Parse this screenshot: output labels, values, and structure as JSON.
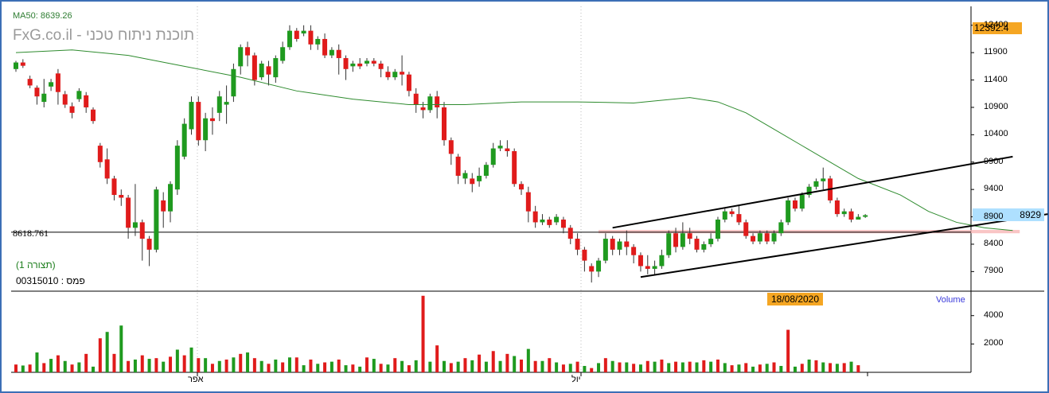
{
  "chart_data": {
    "type": "candlestick",
    "indicator_label": "MA50: 8639.26",
    "watermark": "FxG.co.il - תוכנת ניתוח טכני",
    "last_price_badge": "8929",
    "high_badge": "12392.4",
    "horizontal_line_label": "8618.761",
    "date_badge": "18/08/2020",
    "volume_label": "Volume",
    "meta": {
      "line1": "(תצורה 1)",
      "line2": "פמס : 00315010"
    },
    "y_ticks": [
      "12400",
      "11900",
      "11400",
      "10900",
      "10400",
      "9900",
      "9400",
      "8900",
      "8400",
      "7900"
    ],
    "y_tick_values": [
      12400,
      11900,
      11400,
      10900,
      10400,
      9900,
      9400,
      8900,
      8400,
      7900
    ],
    "volume_ticks": [
      "4000",
      "2000"
    ],
    "volume_tick_values": [
      4000,
      2000
    ],
    "x_ticks": [
      "אפר",
      "יול"
    ],
    "price_range": [
      7600,
      12600
    ],
    "volume_range": [
      0,
      5500
    ],
    "candles": [
      [
        11600,
        11720,
        11550,
        11750,
        0
      ],
      [
        11720,
        11660,
        11620,
        11780,
        0
      ],
      [
        11420,
        11300,
        11250,
        11480,
        0
      ],
      [
        11260,
        11100,
        10950,
        11300,
        0
      ],
      [
        11000,
        11150,
        10900,
        11420,
        0
      ],
      [
        11280,
        11360,
        11200,
        11420,
        0
      ],
      [
        11520,
        11180,
        10950,
        11600,
        0
      ],
      [
        11140,
        10950,
        10890,
        11200,
        0
      ],
      [
        10920,
        10800,
        10700,
        10990,
        0
      ],
      [
        11050,
        11200,
        11000,
        11250,
        0
      ],
      [
        11120,
        10900,
        10800,
        11180,
        0
      ],
      [
        10860,
        10650,
        10600,
        10900,
        0
      ],
      [
        10200,
        9900,
        9800,
        10250,
        0
      ],
      [
        9950,
        9600,
        9500,
        10150,
        0
      ],
      [
        9600,
        9300,
        9200,
        9650,
        0
      ],
      [
        9300,
        9250,
        9100,
        9400,
        0
      ],
      [
        9250,
        8700,
        8500,
        9300,
        0
      ],
      [
        8700,
        8800,
        8550,
        9500,
        0
      ],
      [
        8800,
        8500,
        8100,
        8850,
        0
      ],
      [
        8500,
        8300,
        8000,
        8550,
        0
      ],
      [
        8300,
        9400,
        8250,
        9450,
        0
      ],
      [
        9200,
        9000,
        8700,
        9350,
        0
      ],
      [
        9000,
        9500,
        8800,
        9550,
        0
      ],
      [
        9400,
        10200,
        9300,
        10300,
        0
      ],
      [
        10000,
        10600,
        9950,
        10700,
        0
      ],
      [
        10500,
        11000,
        10400,
        11100,
        0
      ],
      [
        11000,
        10300,
        10200,
        11100,
        0
      ],
      [
        10300,
        10700,
        10100,
        10800,
        0
      ],
      [
        10700,
        10650,
        10400,
        10900,
        0
      ],
      [
        10800,
        11100,
        10650,
        11200,
        0
      ],
      [
        10950,
        11000,
        10600,
        11300,
        0
      ],
      [
        11100,
        11600,
        11000,
        11700,
        0
      ],
      [
        11650,
        12000,
        11500,
        12050,
        0
      ],
      [
        12000,
        11850,
        11650,
        12100,
        0
      ],
      [
        11850,
        11400,
        11300,
        11900,
        0
      ],
      [
        11450,
        11700,
        11400,
        11750,
        0
      ],
      [
        11650,
        11500,
        11300,
        11750,
        0
      ],
      [
        11450,
        11800,
        11350,
        11850,
        0
      ],
      [
        11750,
        12000,
        11700,
        12100,
        0
      ],
      [
        12000,
        12300,
        11950,
        12400,
        0
      ],
      [
        12300,
        12150,
        12100,
        12350,
        0
      ],
      [
        12250,
        12300,
        12200,
        12400,
        0
      ],
      [
        12300,
        12050,
        11950,
        12400,
        0
      ],
      [
        12050,
        12150,
        11950,
        12200,
        0
      ],
      [
        12150,
        11850,
        11800,
        12250,
        0
      ],
      [
        11850,
        11950,
        11800,
        12000,
        0
      ],
      [
        11950,
        11800,
        11500,
        12050,
        0
      ],
      [
        11800,
        11600,
        11400,
        11850,
        0
      ],
      [
        11650,
        11700,
        11550,
        11750,
        0
      ],
      [
        11700,
        11650,
        11600,
        11800,
        0
      ],
      [
        11700,
        11750,
        11650,
        11800,
        0
      ],
      [
        11750,
        11700,
        11650,
        11800,
        0
      ],
      [
        11700,
        11600,
        11450,
        11750,
        0
      ],
      [
        11550,
        11450,
        11400,
        11650,
        0
      ],
      [
        11450,
        11550,
        11400,
        11600,
        0
      ],
      [
        11550,
        11500,
        11300,
        11850,
        0
      ],
      [
        11500,
        11200,
        11100,
        11550,
        0
      ],
      [
        11150,
        10950,
        10800,
        11250,
        0
      ],
      [
        10900,
        10850,
        10700,
        11000,
        0
      ],
      [
        10850,
        11100,
        10800,
        11150,
        0
      ],
      [
        11100,
        10900,
        10700,
        11200,
        0
      ],
      [
        10900,
        10300,
        10200,
        11000,
        0
      ],
      [
        10300,
        10050,
        9850,
        10350,
        0
      ],
      [
        10000,
        9650,
        9500,
        10050,
        0
      ],
      [
        9600,
        9700,
        9500,
        9750,
        0
      ],
      [
        9600,
        9500,
        9350,
        9700,
        0
      ],
      [
        9550,
        9650,
        9450,
        9800,
        0
      ],
      [
        9650,
        9850,
        9600,
        9900,
        0
      ],
      [
        9850,
        10150,
        9800,
        10250,
        0
      ],
      [
        10150,
        10200,
        10100,
        10300,
        0
      ],
      [
        10150,
        10100,
        10000,
        10300,
        0
      ],
      [
        10100,
        9500,
        9450,
        10150,
        0
      ],
      [
        9500,
        9400,
        9300,
        9550,
        0
      ],
      [
        9350,
        9000,
        8800,
        9450,
        0
      ],
      [
        9000,
        8800,
        8700,
        9100,
        0
      ],
      [
        8800,
        8850,
        8750,
        8950,
        0
      ],
      [
        8850,
        8750,
        8700,
        8900,
        0
      ],
      [
        8800,
        8900,
        8750,
        8950,
        0
      ],
      [
        8850,
        8700,
        8600,
        8900,
        0
      ],
      [
        8700,
        8500,
        8400,
        8750,
        0
      ],
      [
        8500,
        8300,
        8200,
        8600,
        0
      ],
      [
        8300,
        8100,
        7900,
        8350,
        0
      ],
      [
        8000,
        7900,
        7700,
        8050,
        0
      ],
      [
        7900,
        8100,
        7800,
        8150,
        0
      ],
      [
        8100,
        8500,
        8050,
        8600,
        0
      ],
      [
        8500,
        8300,
        8200,
        8550,
        0
      ],
      [
        8300,
        8450,
        8200,
        8500,
        0
      ],
      [
        8450,
        8350,
        8200,
        8650,
        0
      ],
      [
        8350,
        8200,
        8050,
        8400,
        0
      ],
      [
        8200,
        8000,
        7900,
        8250,
        0
      ],
      [
        8000,
        7950,
        7850,
        8200,
        0
      ],
      [
        7950,
        8000,
        7850,
        8100,
        0
      ],
      [
        8000,
        8200,
        7950,
        8300,
        0
      ],
      [
        8200,
        8600,
        8150,
        8650,
        0
      ],
      [
        8600,
        8350,
        8250,
        8700,
        0
      ],
      [
        8350,
        8600,
        8300,
        8800,
        0
      ],
      [
        8600,
        8500,
        8400,
        8700,
        0
      ],
      [
        8500,
        8300,
        8250,
        8550,
        0
      ],
      [
        8300,
        8400,
        8250,
        8450,
        0
      ],
      [
        8400,
        8500,
        8350,
        8600,
        0
      ],
      [
        8500,
        8850,
        8450,
        8900,
        0
      ],
      [
        8850,
        9000,
        8800,
        9050,
        0
      ],
      [
        9000,
        8950,
        8900,
        9050,
        0
      ],
      [
        8950,
        8800,
        8750,
        9100,
        0
      ],
      [
        8800,
        8550,
        8500,
        8850,
        0
      ],
      [
        8550,
        8450,
        8400,
        8600,
        0
      ],
      [
        8450,
        8600,
        8400,
        8650,
        0
      ],
      [
        8600,
        8450,
        8400,
        8650,
        0
      ],
      [
        8450,
        8600,
        8400,
        8650,
        0
      ],
      [
        8600,
        8800,
        8550,
        8850,
        0
      ],
      [
        8800,
        9200,
        8750,
        9250,
        0
      ],
      [
        9200,
        9050,
        9000,
        9250,
        0
      ],
      [
        9050,
        9300,
        9000,
        9350,
        0
      ],
      [
        9300,
        9450,
        9250,
        9500,
        0
      ],
      [
        9450,
        9550,
        9400,
        9600,
        0
      ],
      [
        9550,
        9600,
        9400,
        9800,
        0
      ],
      [
        9600,
        9200,
        9150,
        9650,
        0
      ],
      [
        9200,
        8950,
        8900,
        9250,
        0
      ],
      [
        8950,
        9000,
        8900,
        9050,
        0
      ],
      [
        9000,
        8850,
        8800,
        9050,
        0
      ],
      [
        8850,
        8900,
        8850,
        8950,
        0
      ],
      [
        8900,
        8930,
        8880,
        8950,
        0
      ]
    ],
    "volumes": [
      [
        550,
        1
      ],
      [
        480,
        0
      ],
      [
        550,
        1
      ],
      [
        1400,
        0
      ],
      [
        650,
        1
      ],
      [
        950,
        0
      ],
      [
        1200,
        1
      ],
      [
        800,
        0
      ],
      [
        550,
        1
      ],
      [
        700,
        0
      ],
      [
        1300,
        1
      ],
      [
        400,
        0
      ],
      [
        2400,
        1
      ],
      [
        2850,
        0
      ],
      [
        1300,
        1
      ],
      [
        3300,
        0
      ],
      [
        800,
        1
      ],
      [
        900,
        0
      ],
      [
        1200,
        1
      ],
      [
        950,
        0
      ],
      [
        1000,
        1
      ],
      [
        750,
        0
      ],
      [
        1100,
        1
      ],
      [
        1600,
        0
      ],
      [
        1200,
        1
      ],
      [
        1750,
        0
      ],
      [
        1000,
        1
      ],
      [
        1000,
        0
      ],
      [
        600,
        1
      ],
      [
        800,
        0
      ],
      [
        900,
        1
      ],
      [
        1050,
        0
      ],
      [
        1300,
        1
      ],
      [
        1400,
        0
      ],
      [
        1000,
        1
      ],
      [
        800,
        0
      ],
      [
        600,
        1
      ],
      [
        900,
        0
      ],
      [
        700,
        1
      ],
      [
        1050,
        0
      ],
      [
        1050,
        1
      ],
      [
        500,
        0
      ],
      [
        900,
        1
      ],
      [
        600,
        0
      ],
      [
        700,
        1
      ],
      [
        750,
        0
      ],
      [
        900,
        1
      ],
      [
        500,
        0
      ],
      [
        550,
        1
      ],
      [
        400,
        0
      ],
      [
        1050,
        1
      ],
      [
        950,
        0
      ],
      [
        600,
        1
      ],
      [
        550,
        0
      ],
      [
        1000,
        1
      ],
      [
        800,
        0
      ],
      [
        500,
        1
      ],
      [
        850,
        0
      ],
      [
        5400,
        1
      ],
      [
        750,
        0
      ],
      [
        1900,
        1
      ],
      [
        800,
        0
      ],
      [
        650,
        1
      ],
      [
        750,
        0
      ],
      [
        1000,
        1
      ],
      [
        850,
        0
      ],
      [
        1250,
        1
      ],
      [
        750,
        0
      ],
      [
        1500,
        1
      ],
      [
        800,
        0
      ],
      [
        1300,
        1
      ],
      [
        1150,
        0
      ],
      [
        900,
        1
      ],
      [
        1650,
        0
      ],
      [
        800,
        1
      ],
      [
        800,
        0
      ],
      [
        1000,
        1
      ],
      [
        700,
        0
      ],
      [
        550,
        1
      ],
      [
        600,
        0
      ],
      [
        750,
        1
      ],
      [
        450,
        0
      ],
      [
        300,
        1
      ],
      [
        650,
        0
      ],
      [
        1000,
        1
      ],
      [
        800,
        0
      ],
      [
        700,
        1
      ],
      [
        700,
        0
      ],
      [
        600,
        1
      ],
      [
        550,
        0
      ],
      [
        800,
        1
      ],
      [
        750,
        0
      ],
      [
        900,
        1
      ],
      [
        650,
        0
      ],
      [
        750,
        1
      ],
      [
        700,
        0
      ],
      [
        750,
        1
      ],
      [
        700,
        0
      ],
      [
        850,
        1
      ],
      [
        750,
        0
      ],
      [
        900,
        1
      ],
      [
        650,
        0
      ],
      [
        500,
        1
      ],
      [
        550,
        0
      ],
      [
        650,
        1
      ],
      [
        400,
        0
      ],
      [
        550,
        1
      ],
      [
        600,
        0
      ],
      [
        700,
        1
      ],
      [
        450,
        0
      ],
      [
        3000,
        1
      ],
      [
        400,
        0
      ],
      [
        600,
        1
      ],
      [
        900,
        0
      ],
      [
        850,
        1
      ],
      [
        700,
        0
      ],
      [
        650,
        1
      ],
      [
        600,
        0
      ],
      [
        650,
        1
      ],
      [
        750,
        0
      ],
      [
        500,
        1
      ]
    ],
    "ma50": [
      [
        0,
        11900
      ],
      [
        8,
        11950
      ],
      [
        16,
        11850
      ],
      [
        24,
        11650
      ],
      [
        32,
        11450
      ],
      [
        40,
        11200
      ],
      [
        48,
        11050
      ],
      [
        56,
        10950
      ],
      [
        64,
        10950
      ],
      [
        72,
        11000
      ],
      [
        80,
        11000
      ],
      [
        88,
        10980
      ],
      [
        96,
        11080
      ],
      [
        100,
        11000
      ],
      [
        104,
        10800
      ],
      [
        108,
        10500
      ],
      [
        112,
        10200
      ],
      [
        116,
        9900
      ],
      [
        120,
        9600
      ],
      [
        126,
        9300
      ],
      [
        130,
        9000
      ],
      [
        134,
        8800
      ],
      [
        138,
        8700
      ],
      [
        142,
        8650
      ]
    ],
    "horizontal_line": 8618.761,
    "support_band": [
      8660,
      8600
    ],
    "channel_upper": [
      [
        85,
        8700
      ],
      [
        142,
        10000
      ]
    ],
    "channel_lower": [
      [
        89,
        7800
      ],
      [
        147,
        8950
      ]
    ],
    "grid": true
  }
}
